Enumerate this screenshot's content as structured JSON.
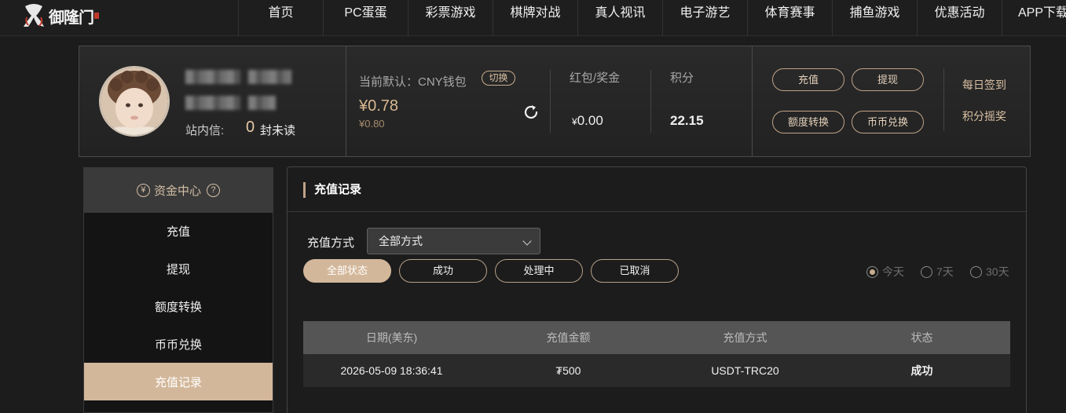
{
  "nav": {
    "logo_text": "御隆门",
    "items": [
      "首页",
      "PC蛋蛋",
      "彩票游戏",
      "棋牌对战",
      "真人视讯",
      "电子游艺",
      "体育赛事",
      "捕鱼游戏",
      "优惠活动",
      "APP下载"
    ]
  },
  "profile": {
    "inbox_label": "站内信:",
    "inbox_count": "0",
    "inbox_unit": "封未读",
    "wallet_label": "当前默认：CNY钱包",
    "switch_label": "切换",
    "balance_main": "¥0.78",
    "balance_sub": "¥0.80",
    "hongbao_label": "红包/奖金",
    "hongbao_currency": "¥",
    "hongbao_value": "0.00",
    "points_label": "积分",
    "points_value": "22.15",
    "buttons": [
      "充值",
      "提现",
      "额度转换",
      "币币兑换"
    ],
    "links": [
      "每日签到",
      "积分摇奖"
    ]
  },
  "sidebar": {
    "title": "资金中心",
    "coin_icon": "¥",
    "help_icon": "?",
    "items": [
      "充值",
      "提现",
      "额度转换",
      "币币兑换",
      "充值记录"
    ],
    "active_index": 4
  },
  "main": {
    "title": "充值记录",
    "method_label": "充值方式",
    "method_value": "全部方式",
    "status_filters": [
      "全部状态",
      "成功",
      "处理中",
      "已取消"
    ],
    "active_status": 0,
    "ranges": [
      "今天",
      "7天",
      "30天"
    ],
    "active_range": 0,
    "table": {
      "headers": [
        "日期(美东)",
        "充值金额",
        "充值方式",
        "状态"
      ],
      "rows": [
        [
          "2026-05-09 18:36:41",
          "₮500",
          "USDT-TRC20",
          "成功"
        ]
      ]
    }
  },
  "colors": {
    "accent": "#d3b79a",
    "gold_text": "#d9b991",
    "bg": "#1c1c1c"
  }
}
